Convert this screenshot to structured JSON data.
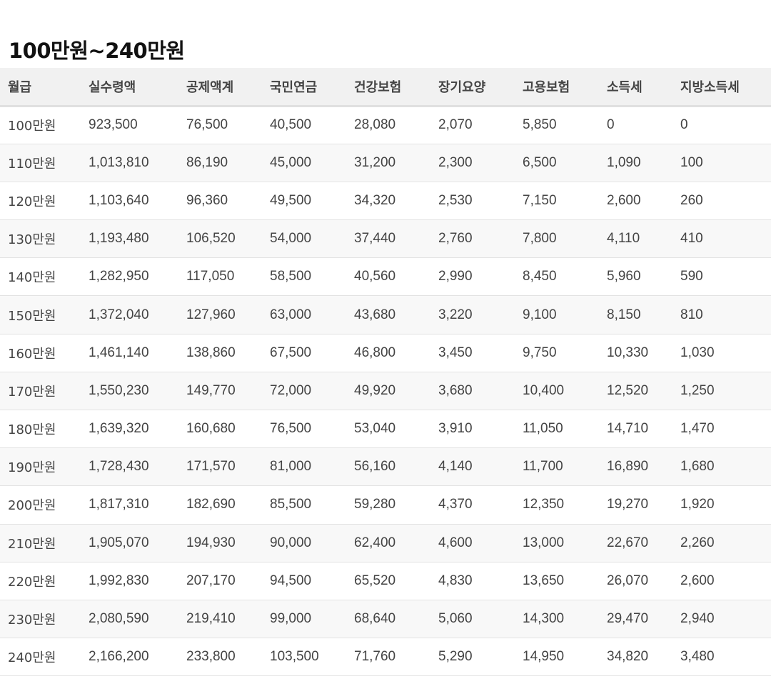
{
  "title": "100만원~240만원",
  "table": {
    "headers": [
      "월급",
      "실수령액",
      "공제액계",
      "국민연금",
      "건강보험",
      "장기요양",
      "고용보험",
      "소득세",
      "지방소득세"
    ],
    "rows": [
      [
        "100만원",
        "923,500",
        "76,500",
        "40,500",
        "28,080",
        "2,070",
        "5,850",
        "0",
        "0"
      ],
      [
        "110만원",
        "1,013,810",
        "86,190",
        "45,000",
        "31,200",
        "2,300",
        "6,500",
        "1,090",
        "100"
      ],
      [
        "120만원",
        "1,103,640",
        "96,360",
        "49,500",
        "34,320",
        "2,530",
        "7,150",
        "2,600",
        "260"
      ],
      [
        "130만원",
        "1,193,480",
        "106,520",
        "54,000",
        "37,440",
        "2,760",
        "7,800",
        "4,110",
        "410"
      ],
      [
        "140만원",
        "1,282,950",
        "117,050",
        "58,500",
        "40,560",
        "2,990",
        "8,450",
        "5,960",
        "590"
      ],
      [
        "150만원",
        "1,372,040",
        "127,960",
        "63,000",
        "43,680",
        "3,220",
        "9,100",
        "8,150",
        "810"
      ],
      [
        "160만원",
        "1,461,140",
        "138,860",
        "67,500",
        "46,800",
        "3,450",
        "9,750",
        "10,330",
        "1,030"
      ],
      [
        "170만원",
        "1,550,230",
        "149,770",
        "72,000",
        "49,920",
        "3,680",
        "10,400",
        "12,520",
        "1,250"
      ],
      [
        "180만원",
        "1,639,320",
        "160,680",
        "76,500",
        "53,040",
        "3,910",
        "11,050",
        "14,710",
        "1,470"
      ],
      [
        "190만원",
        "1,728,430",
        "171,570",
        "81,000",
        "56,160",
        "4,140",
        "11,700",
        "16,890",
        "1,680"
      ],
      [
        "200만원",
        "1,817,310",
        "182,690",
        "85,500",
        "59,280",
        "4,370",
        "12,350",
        "19,270",
        "1,920"
      ],
      [
        "210만원",
        "1,905,070",
        "194,930",
        "90,000",
        "62,400",
        "4,600",
        "13,000",
        "22,670",
        "2,260"
      ],
      [
        "220만원",
        "1,992,830",
        "207,170",
        "94,500",
        "65,520",
        "4,830",
        "13,650",
        "26,070",
        "2,600"
      ],
      [
        "230만원",
        "2,080,590",
        "219,410",
        "99,000",
        "68,640",
        "5,060",
        "14,300",
        "29,470",
        "2,940"
      ],
      [
        "240만원",
        "2,166,200",
        "233,800",
        "103,500",
        "71,760",
        "5,290",
        "14,950",
        "34,820",
        "3,480"
      ]
    ]
  }
}
